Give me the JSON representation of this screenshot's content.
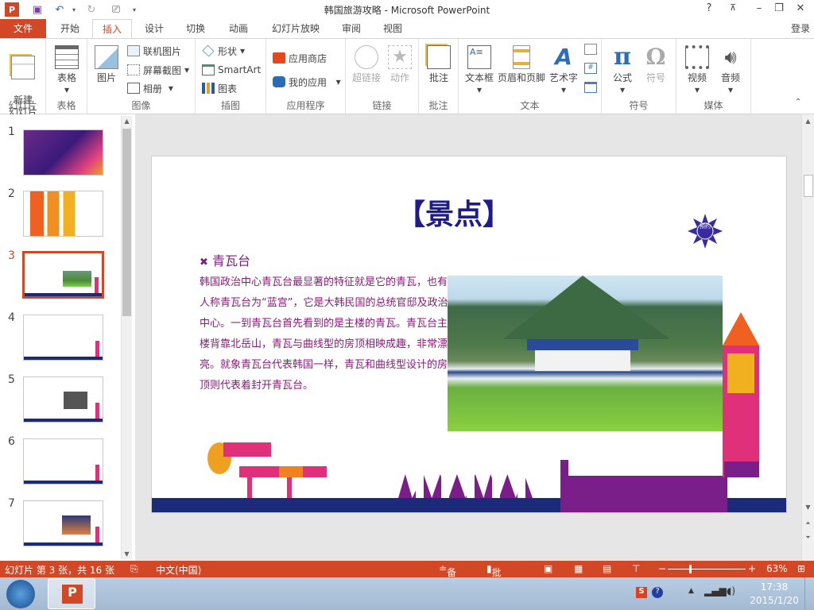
{
  "window": {
    "title": "韩国旅游攻略 - Microsoft PowerPoint",
    "help": "?",
    "ribbon_display": "⊼",
    "minimize": "–",
    "restore": "❐",
    "close": "✕",
    "signin": "登录"
  },
  "quick_access": {
    "app_icon": "P",
    "save": "save-icon",
    "undo": "undo-icon",
    "redo": "redo-icon",
    "present": "start-from-beginning-icon",
    "customize": "customize-icon"
  },
  "tabs": [
    {
      "label": "文件"
    },
    {
      "label": "开始"
    },
    {
      "label": "插入",
      "active": true
    },
    {
      "label": "设计"
    },
    {
      "label": "切换"
    },
    {
      "label": "动画"
    },
    {
      "label": "幻灯片放映"
    },
    {
      "label": "审阅"
    },
    {
      "label": "视图"
    }
  ],
  "ribbon": {
    "groups": {
      "slides": "幻灯片",
      "tables": "表格",
      "images": "图像",
      "illustrations": "插图",
      "apps": "应用程序",
      "links": "链接",
      "comments": "批注",
      "text": "文本",
      "symbols": "符号",
      "media": "媒体"
    },
    "new_slide": "新建\n幻灯片",
    "table": "表格",
    "picture": "图片",
    "online_pictures": "联机图片",
    "screenshot": "屏幕截图",
    "photo_album": "相册",
    "shapes": "形状",
    "smartart": "SmartArt",
    "chart": "图表",
    "store": "应用商店",
    "my_apps": "我的应用",
    "hyperlink": "超链接",
    "action": "动作",
    "comment": "批注",
    "textbox": "文本框",
    "header_footer": "页眉和页脚",
    "wordart": "艺术字",
    "equation": "公式",
    "symbol": "符号",
    "video": "视频",
    "audio": "音频"
  },
  "thumbnails": [
    {
      "num": "1"
    },
    {
      "num": "2"
    },
    {
      "num": "3",
      "selected": true
    },
    {
      "num": "4"
    },
    {
      "num": "5"
    },
    {
      "num": "6"
    },
    {
      "num": "7"
    }
  ],
  "slide": {
    "title": "【景点】",
    "badge": "预约",
    "heading_bullet": "✖",
    "heading": "青瓦台",
    "body": "韩国政治中心青瓦台最显著的特征就是它的青瓦，也有人称青瓦台为“蓝宫”，它是大韩民国的总统官邸及政治中心。一到青瓦台首先看到的是主楼的青瓦。青瓦台主楼背靠北岳山，青瓦与曲线型的房顶相映成趣，非常漂亮。就象青瓦台代表韩国一样，青瓦和曲线型设计的房顶则代表着封开青瓦台。"
  },
  "status": {
    "slide_info": "幻灯片 第 3 张，共 16 张",
    "language": "中文(中国)",
    "notes": "备注",
    "comments": "批注",
    "zoom": "63%",
    "zoom_fraction": 0.63
  },
  "taskbar": {
    "time": "17:38",
    "date": "2015/1/20"
  },
  "colors": {
    "accent": "#d24726",
    "title": "#1c1c8f",
    "body": "#8b1a78"
  }
}
